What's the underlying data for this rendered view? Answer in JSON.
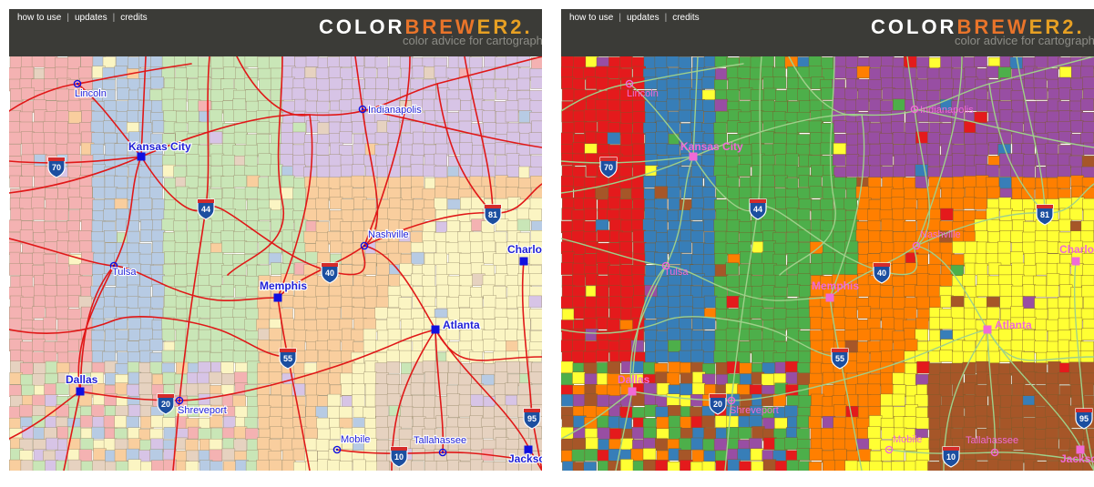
{
  "nav": {
    "how_to_use": "how to use",
    "updates": "updates",
    "credits": "credits"
  },
  "brand": {
    "part1": "COLOR",
    "part2": "BREW",
    "part3": "ER",
    "version": "2.",
    "tagline": "color advice for cartograph"
  },
  "panels": [
    {
      "id": "left",
      "label_color": "#1f1fd6",
      "marker_color": "#1010e0",
      "road_color": "#e01818",
      "cities": [
        {
          "name": "Lincoln",
          "major": false
        },
        {
          "name": "Indianapolis",
          "major": false
        },
        {
          "name": "Kansas City",
          "major": true
        },
        {
          "name": "Nashville",
          "major": false
        },
        {
          "name": "Tulsa",
          "major": false
        },
        {
          "name": "Memphis",
          "major": true
        },
        {
          "name": "Atlanta",
          "major": true
        },
        {
          "name": "Charlo",
          "major": true
        },
        {
          "name": "Dallas",
          "major": true
        },
        {
          "name": "Shreveport",
          "major": false
        },
        {
          "name": "Mobile",
          "major": false
        },
        {
          "name": "Tallahassee",
          "major": false
        },
        {
          "name": "Jackson",
          "major": true
        }
      ],
      "shields": [
        "70",
        "44",
        "81",
        "40",
        "55",
        "20",
        "10",
        "95"
      ]
    },
    {
      "id": "right",
      "label_color": "#f06ad6",
      "marker_color": "#f06ad6",
      "road_color": "#9fd08a",
      "cities": [
        {
          "name": "Lincoln",
          "major": false
        },
        {
          "name": "Indianapolis",
          "major": false
        },
        {
          "name": "Kansas City",
          "major": true
        },
        {
          "name": "Nashville",
          "major": false
        },
        {
          "name": "Tulsa",
          "major": false
        },
        {
          "name": "Memphis",
          "major": true
        },
        {
          "name": "Atlanta",
          "major": true
        },
        {
          "name": "Charlo",
          "major": true
        },
        {
          "name": "Dallas",
          "major": true
        },
        {
          "name": "Shreveport",
          "major": false
        },
        {
          "name": "Mobile",
          "major": false
        },
        {
          "name": "Tallahassee",
          "major": false
        },
        {
          "name": "Jackson",
          "major": true
        }
      ],
      "shields": [
        "70",
        "44",
        "81",
        "40",
        "55",
        "20",
        "10",
        "95"
      ]
    }
  ],
  "colors": {
    "header_bg": "#3b3b37",
    "brand_light": "#ffffff",
    "brand_orange": "#e9742a",
    "brand_yellow": "#e7a023",
    "pastel_regions": [
      "#f4b2b2",
      "#b7cbe4",
      "#c9e6b7",
      "#d7c4e6",
      "#f9ce9e",
      "#fbf5c3",
      "#e6d2c0"
    ],
    "bold_regions": [
      "#e41a1c",
      "#377eb8",
      "#4daf4a",
      "#984ea3",
      "#ff7f00",
      "#ffff33",
      "#a65628"
    ]
  }
}
